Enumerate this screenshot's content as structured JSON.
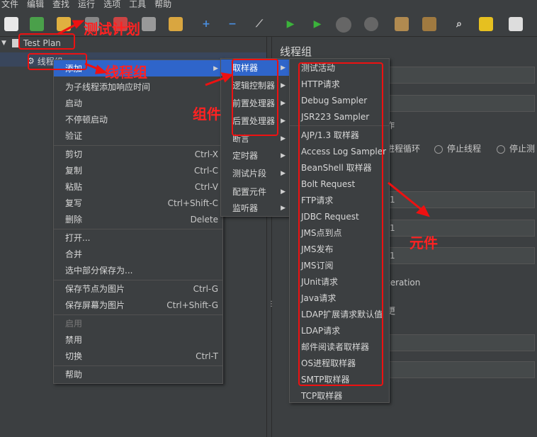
{
  "menubar": [
    "文件",
    "编辑",
    "查找",
    "运行",
    "选项",
    "工具",
    "帮助"
  ],
  "colors": {
    "accent": "#2f65ca",
    "annotation": "#ee1111"
  },
  "tree": {
    "test_plan": "Test Plan",
    "thread_group": "线程组"
  },
  "right_panel": {
    "title": "线程组",
    "partial_action": "作",
    "loop_tail": "进程循环",
    "stop_thread": "停止线程",
    "stop_test": "停止测",
    "v1": "1",
    "v2": "1",
    "v3": "1",
    "iteration": "teration",
    "misc": "更"
  },
  "context_menu": {
    "add": "添加",
    "add_response_time": "为子线程添加响应时间",
    "start": "启动",
    "start_no_pause": "不停顿启动",
    "validate": "验证",
    "cut": "剪切",
    "cut_sc": "Ctrl-X",
    "copy": "复制",
    "copy_sc": "Ctrl-C",
    "paste": "粘贴",
    "paste_sc": "Ctrl-V",
    "duplicate": "复写",
    "duplicate_sc": "Ctrl+Shift-C",
    "delete": "删除",
    "delete_sc": "Delete",
    "open": "打开...",
    "merge": "合并",
    "save_selection": "选中部分保存为...",
    "save_node_img": "保存节点为图片",
    "save_node_img_sc": "Ctrl-G",
    "save_screen_img": "保存屏幕为图片",
    "save_screen_img_sc": "Ctrl+Shift-G",
    "enable": "启用",
    "disable": "禁用",
    "toggle": "切换",
    "toggle_sc": "Ctrl-T",
    "help": "帮助"
  },
  "add_submenu": [
    "取样器",
    "逻辑控制器",
    "前置处理器",
    "后置处理器",
    "断言",
    "定时器",
    "测试片段",
    "配置元件",
    "监听器"
  ],
  "sampler_submenu": [
    "测试活动",
    "HTTP请求",
    "Debug Sampler",
    "JSR223 Sampler",
    "AJP/1.3 取样器",
    "Access Log Sampler",
    "BeanShell 取样器",
    "Bolt Request",
    "FTP请求",
    "JDBC Request",
    "JMS点到点",
    "JMS发布",
    "JMS订阅",
    "JUnit请求",
    "Java请求",
    "LDAP扩展请求默认值",
    "LDAP请求",
    "邮件阅读者取样器",
    "OS进程取样器",
    "SMTP取样器",
    "TCP取样器"
  ],
  "annotations": {
    "test_plan": "测试计划",
    "thread_group": "线程组",
    "component": "组件",
    "element": "元件"
  }
}
